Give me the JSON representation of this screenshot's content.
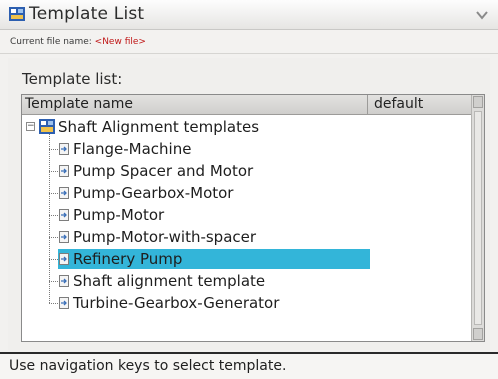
{
  "window": {
    "title": "Template List",
    "app_icon": "alignment-app-icon",
    "menu_icon": "menu-arrow-icon"
  },
  "file_info": {
    "label": "Current file name: ",
    "value": "<New file>"
  },
  "template_list": {
    "caption": "Template list:",
    "columns": {
      "name": "Template name",
      "default": "default"
    },
    "root": {
      "expander": "−",
      "label": "Shaft Alignment templates",
      "icon": "folder-app-icon"
    },
    "items": [
      {
        "label": "Flange-Machine",
        "selected": false
      },
      {
        "label": "Pump Spacer and Motor",
        "selected": false
      },
      {
        "label": "Pump-Gearbox-Motor",
        "selected": false
      },
      {
        "label": "Pump-Motor",
        "selected": false
      },
      {
        "label": "Pump-Motor-with-spacer",
        "selected": false
      },
      {
        "label": "Refinery Pump",
        "selected": true
      },
      {
        "label": "Shaft alignment template",
        "selected": false
      },
      {
        "label": "Turbine-Gearbox-Generator",
        "selected": false
      }
    ],
    "item_icon": "document-arrow-icon"
  },
  "status": {
    "text": "Use navigation keys to select template."
  },
  "colors": {
    "selection": "#33b5d9",
    "file_value": "#c01818",
    "status_border": "#2a2a2a"
  }
}
